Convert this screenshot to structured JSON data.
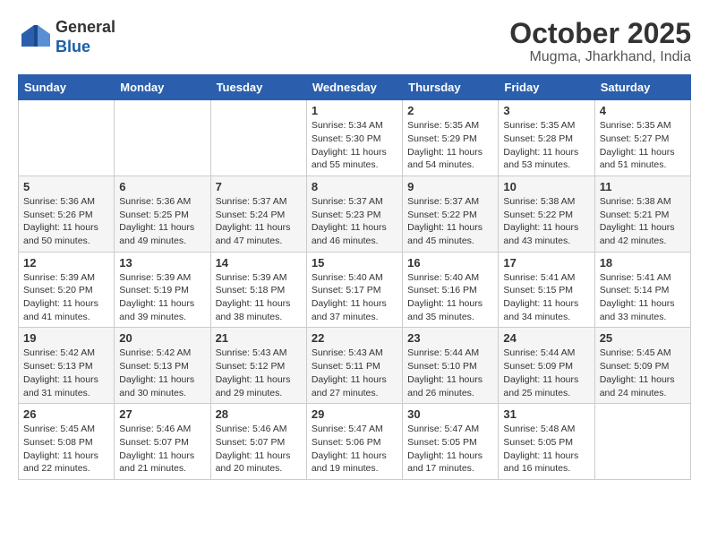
{
  "header": {
    "logo_general": "General",
    "logo_blue": "Blue",
    "month_title": "October 2025",
    "location": "Mugma, Jharkhand, India"
  },
  "weekdays": [
    "Sunday",
    "Monday",
    "Tuesday",
    "Wednesday",
    "Thursday",
    "Friday",
    "Saturday"
  ],
  "weeks": [
    [
      {
        "day": "",
        "content": ""
      },
      {
        "day": "",
        "content": ""
      },
      {
        "day": "",
        "content": ""
      },
      {
        "day": "1",
        "content": "Sunrise: 5:34 AM\nSunset: 5:30 PM\nDaylight: 11 hours and 55 minutes."
      },
      {
        "day": "2",
        "content": "Sunrise: 5:35 AM\nSunset: 5:29 PM\nDaylight: 11 hours and 54 minutes."
      },
      {
        "day": "3",
        "content": "Sunrise: 5:35 AM\nSunset: 5:28 PM\nDaylight: 11 hours and 53 minutes."
      },
      {
        "day": "4",
        "content": "Sunrise: 5:35 AM\nSunset: 5:27 PM\nDaylight: 11 hours and 51 minutes."
      }
    ],
    [
      {
        "day": "5",
        "content": "Sunrise: 5:36 AM\nSunset: 5:26 PM\nDaylight: 11 hours and 50 minutes."
      },
      {
        "day": "6",
        "content": "Sunrise: 5:36 AM\nSunset: 5:25 PM\nDaylight: 11 hours and 49 minutes."
      },
      {
        "day": "7",
        "content": "Sunrise: 5:37 AM\nSunset: 5:24 PM\nDaylight: 11 hours and 47 minutes."
      },
      {
        "day": "8",
        "content": "Sunrise: 5:37 AM\nSunset: 5:23 PM\nDaylight: 11 hours and 46 minutes."
      },
      {
        "day": "9",
        "content": "Sunrise: 5:37 AM\nSunset: 5:22 PM\nDaylight: 11 hours and 45 minutes."
      },
      {
        "day": "10",
        "content": "Sunrise: 5:38 AM\nSunset: 5:22 PM\nDaylight: 11 hours and 43 minutes."
      },
      {
        "day": "11",
        "content": "Sunrise: 5:38 AM\nSunset: 5:21 PM\nDaylight: 11 hours and 42 minutes."
      }
    ],
    [
      {
        "day": "12",
        "content": "Sunrise: 5:39 AM\nSunset: 5:20 PM\nDaylight: 11 hours and 41 minutes."
      },
      {
        "day": "13",
        "content": "Sunrise: 5:39 AM\nSunset: 5:19 PM\nDaylight: 11 hours and 39 minutes."
      },
      {
        "day": "14",
        "content": "Sunrise: 5:39 AM\nSunset: 5:18 PM\nDaylight: 11 hours and 38 minutes."
      },
      {
        "day": "15",
        "content": "Sunrise: 5:40 AM\nSunset: 5:17 PM\nDaylight: 11 hours and 37 minutes."
      },
      {
        "day": "16",
        "content": "Sunrise: 5:40 AM\nSunset: 5:16 PM\nDaylight: 11 hours and 35 minutes."
      },
      {
        "day": "17",
        "content": "Sunrise: 5:41 AM\nSunset: 5:15 PM\nDaylight: 11 hours and 34 minutes."
      },
      {
        "day": "18",
        "content": "Sunrise: 5:41 AM\nSunset: 5:14 PM\nDaylight: 11 hours and 33 minutes."
      }
    ],
    [
      {
        "day": "19",
        "content": "Sunrise: 5:42 AM\nSunset: 5:13 PM\nDaylight: 11 hours and 31 minutes."
      },
      {
        "day": "20",
        "content": "Sunrise: 5:42 AM\nSunset: 5:13 PM\nDaylight: 11 hours and 30 minutes."
      },
      {
        "day": "21",
        "content": "Sunrise: 5:43 AM\nSunset: 5:12 PM\nDaylight: 11 hours and 29 minutes."
      },
      {
        "day": "22",
        "content": "Sunrise: 5:43 AM\nSunset: 5:11 PM\nDaylight: 11 hours and 27 minutes."
      },
      {
        "day": "23",
        "content": "Sunrise: 5:44 AM\nSunset: 5:10 PM\nDaylight: 11 hours and 26 minutes."
      },
      {
        "day": "24",
        "content": "Sunrise: 5:44 AM\nSunset: 5:09 PM\nDaylight: 11 hours and 25 minutes."
      },
      {
        "day": "25",
        "content": "Sunrise: 5:45 AM\nSunset: 5:09 PM\nDaylight: 11 hours and 24 minutes."
      }
    ],
    [
      {
        "day": "26",
        "content": "Sunrise: 5:45 AM\nSunset: 5:08 PM\nDaylight: 11 hours and 22 minutes."
      },
      {
        "day": "27",
        "content": "Sunrise: 5:46 AM\nSunset: 5:07 PM\nDaylight: 11 hours and 21 minutes."
      },
      {
        "day": "28",
        "content": "Sunrise: 5:46 AM\nSunset: 5:07 PM\nDaylight: 11 hours and 20 minutes."
      },
      {
        "day": "29",
        "content": "Sunrise: 5:47 AM\nSunset: 5:06 PM\nDaylight: 11 hours and 19 minutes."
      },
      {
        "day": "30",
        "content": "Sunrise: 5:47 AM\nSunset: 5:05 PM\nDaylight: 11 hours and 17 minutes."
      },
      {
        "day": "31",
        "content": "Sunrise: 5:48 AM\nSunset: 5:05 PM\nDaylight: 11 hours and 16 minutes."
      },
      {
        "day": "",
        "content": ""
      }
    ]
  ]
}
